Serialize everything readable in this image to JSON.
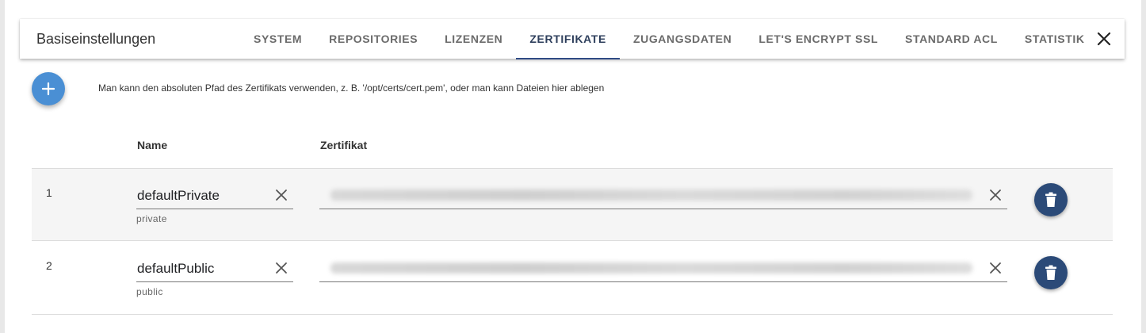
{
  "dialog": {
    "title": "Basiseinstellungen",
    "tabs": [
      {
        "label": "SYSTEM"
      },
      {
        "label": "REPOSITORIES"
      },
      {
        "label": "LIZENZEN"
      },
      {
        "label": "ZERTIFIKATE"
      },
      {
        "label": "ZUGANGSDATEN"
      },
      {
        "label": "LET'S ENCRYPT SSL"
      },
      {
        "label": "STANDARD ACL"
      },
      {
        "label": "STATISTIK"
      }
    ],
    "active_tab": "ZERTIFIKATE",
    "close_icon": "close-icon"
  },
  "certificates": {
    "hint": "Man kann den absoluten Pfad des Zertifikats verwenden, z. B. '/opt/certs/cert.pem', oder man kann Dateien hier ablegen",
    "add_icon": "plus-icon",
    "columns": {
      "name": "Name",
      "cert": "Zertifikat"
    },
    "rows": [
      {
        "index": "1",
        "name": "defaultPrivate",
        "helper": "private"
      },
      {
        "index": "2",
        "name": "defaultPublic",
        "helper": "public"
      }
    ]
  },
  "colors": {
    "accent": "#2f4a84",
    "add_button": "#4a8fd4",
    "delete_button": "#2b4a78"
  }
}
